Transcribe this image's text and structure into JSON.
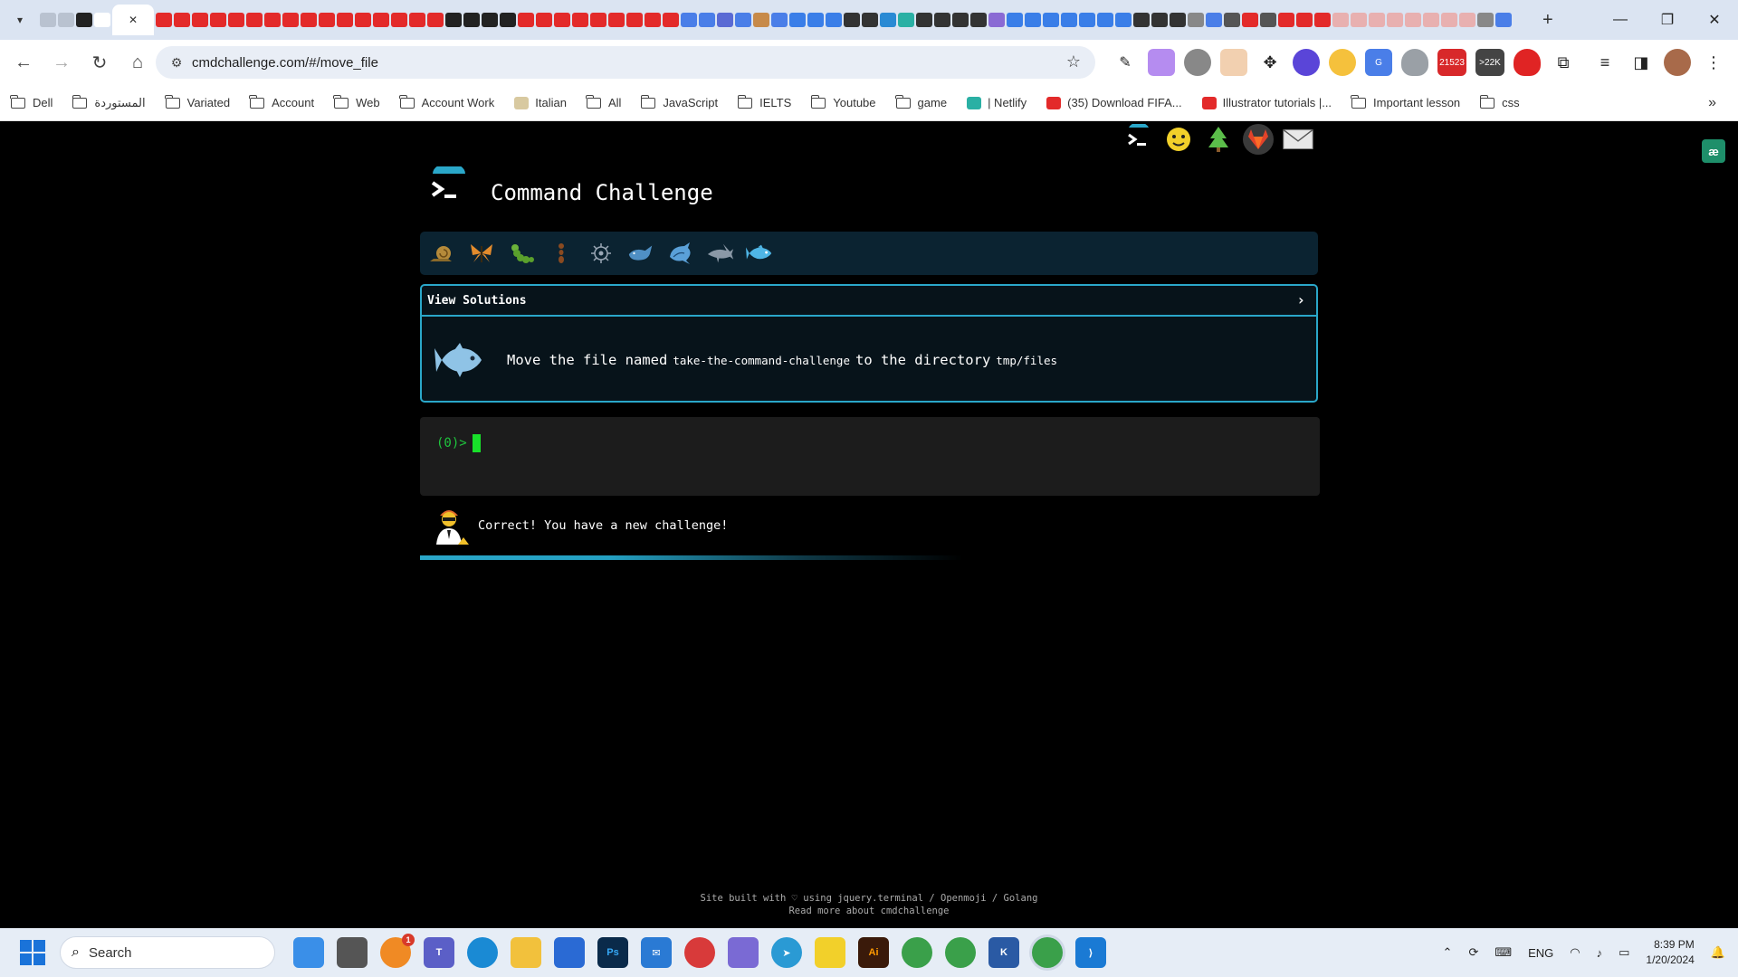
{
  "browser": {
    "url": "cmdchallenge.com/#/move_file",
    "bookmarks": [
      {
        "label": "Dell",
        "kind": "folder"
      },
      {
        "label": "المستوردة",
        "kind": "folder"
      },
      {
        "label": "Variated",
        "kind": "folder"
      },
      {
        "label": "Account",
        "kind": "folder"
      },
      {
        "label": "Web",
        "kind": "folder"
      },
      {
        "label": "Account Work",
        "kind": "folder"
      },
      {
        "label": "Italian",
        "kind": "page"
      },
      {
        "label": "All",
        "kind": "folder"
      },
      {
        "label": "JavaScript",
        "kind": "folder"
      },
      {
        "label": "IELTS",
        "kind": "folder"
      },
      {
        "label": "Youtube",
        "kind": "folder"
      },
      {
        "label": "game",
        "kind": "folder"
      },
      {
        "label": "| Netlify",
        "kind": "page"
      },
      {
        "label": "(35) Download FIFA...",
        "kind": "page"
      },
      {
        "label": "Illustrator tutorials |...",
        "kind": "page"
      },
      {
        "label": "Important lesson",
        "kind": "folder"
      },
      {
        "label": "css",
        "kind": "folder"
      }
    ],
    "extension_badges": [
      "21523",
      ">22K"
    ]
  },
  "page": {
    "title": "Command Challenge",
    "view_solutions_label": "View Solutions",
    "challenge": {
      "prefix": "Move the file named",
      "file": "take-the-command-challenge",
      "middle": "to the directory",
      "dir": "tmp/files"
    },
    "terminal": {
      "prompt": "(0)>"
    },
    "feedback": "Correct! You have a new challenge!",
    "footer_line1": "Site built with ♡ using jquery.terminal / Openmoji / Golang",
    "footer_line2": "Read more about cmdchallenge"
  },
  "taskbar": {
    "search_placeholder": "Search",
    "notification_count": "1",
    "tray": {
      "language": "ENG",
      "time": "8:39 PM",
      "date": "1/20/2024"
    }
  },
  "colors": {
    "accent": "#2aa7c9",
    "level_bar": "#0b2331",
    "prompt": "#1fc53d",
    "cursor": "#18e02a"
  }
}
